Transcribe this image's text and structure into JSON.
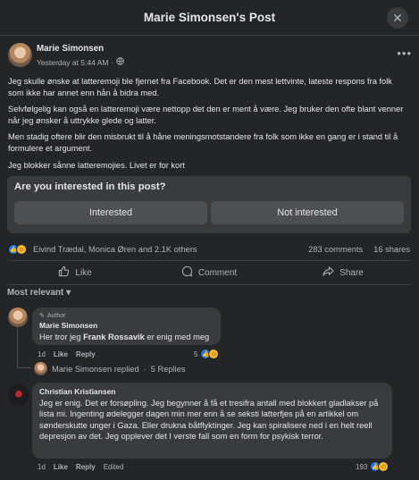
{
  "window": {
    "title": "Marie Simonsen's Post"
  },
  "post": {
    "author": "Marie Simonsen",
    "time": "Yesterday at 5:44 AM",
    "separator": "·",
    "paragraphs": [
      "Jeg skulle ønske at latteremoji ble fjernet fra Facebook. Det er den mest lettvinte, lateste respons fra folk som ikke har annet enn hån å bidra med.",
      "Selvfølgelig kan også en latteremoji være nettopp det den er ment å være. Jeg bruker den ofte blant venner når jeg ønsker å uttrykke glede og latter.",
      "Men stadig oftere blir den misbrukt til å håne meningsmotstandere fra folk som ikke en gang er i stand til å formulere et argument.",
      "Jeg blokker sånne latteremojies. Livet er for kort"
    ]
  },
  "interest": {
    "question": "Are you interested in this post?",
    "yes_label": "Interested",
    "no_label": "Not interested"
  },
  "stats": {
    "reactors": "Eivind Trædal, Monica Øren and 2.1K others",
    "comments": "283 comments",
    "shares": "16 shares"
  },
  "actions": {
    "like": "Like",
    "comment": "Comment",
    "share": "Share"
  },
  "sort": {
    "label": "Most relevant"
  },
  "comments": [
    {
      "badge": "Author",
      "author": "Marie Simonsen",
      "text_before": "Her tror jeg ",
      "mention": "Frank Rossavik",
      "text_after": " er enig med meg",
      "time": "1d",
      "like": "Like",
      "reply": "Reply",
      "reactions": "5",
      "replies_text": "Marie Simonsen replied",
      "replies_sep": "·",
      "replies_count": "5 Replies"
    },
    {
      "author": "Christian Kristiansen",
      "text": "Jeg er enig. Det er forsøpling. Jeg begynner å få et tresifra antall med blokkert gladlakser på lista mi. Ingenting ødelegger dagen min mer enn å se seksti latterfjes på en artikkel om sønderskutte unger i Gaza. Eller drukna båtflyktinger. Jeg kan spiralisere ned i en helt reell depresjon av det. Jeg opplever det I verste fall som en form for psykisk terror.",
      "time": "1d",
      "like": "Like",
      "reply": "Reply",
      "edited": "Edited",
      "reactions": "193"
    }
  ],
  "colors": {
    "background": "#242526",
    "surface": "#3a3b3c",
    "text": "#e4e6eb",
    "muted": "#b0b3b8",
    "like_blue": "#2078f4",
    "haha_yellow": "#f7b928"
  }
}
